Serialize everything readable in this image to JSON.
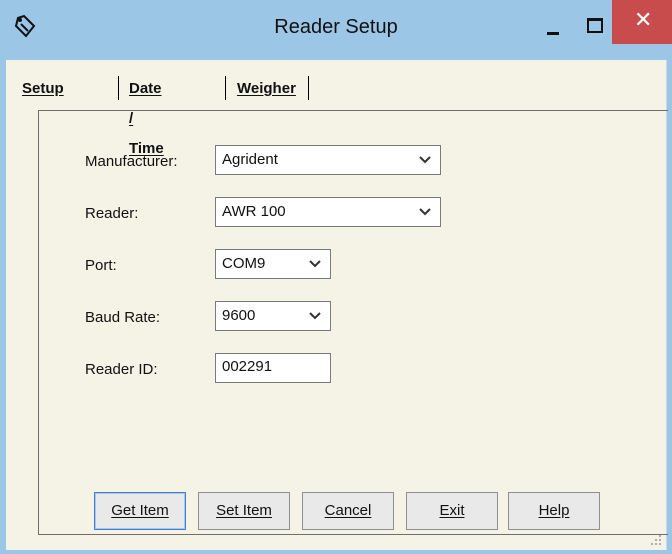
{
  "window": {
    "title": "Reader Setup",
    "close_glyph": "✕"
  },
  "tabs": [
    {
      "label": "Setup"
    },
    {
      "label": "Date / Time"
    },
    {
      "label": "Weigher"
    }
  ],
  "form": {
    "manufacturer": {
      "label": "Manufacturer:",
      "value": "Agrident"
    },
    "reader": {
      "label": "Reader:",
      "value": "AWR 100"
    },
    "port": {
      "label": "Port:",
      "value": "COM9"
    },
    "baud_rate": {
      "label": "Baud Rate:",
      "value": "9600"
    },
    "reader_id": {
      "label": "Reader ID:",
      "value": "002291"
    }
  },
  "buttons": {
    "get_item": "Get Item",
    "set_item": "Set Item",
    "cancel": "Cancel",
    "exit": "Exit",
    "help": "Help"
  },
  "colors": {
    "titlebar": "#9bc6e6",
    "close": "#c84c4c",
    "client": "#f5f2e6",
    "default_button_border": "#3c7fd0"
  }
}
